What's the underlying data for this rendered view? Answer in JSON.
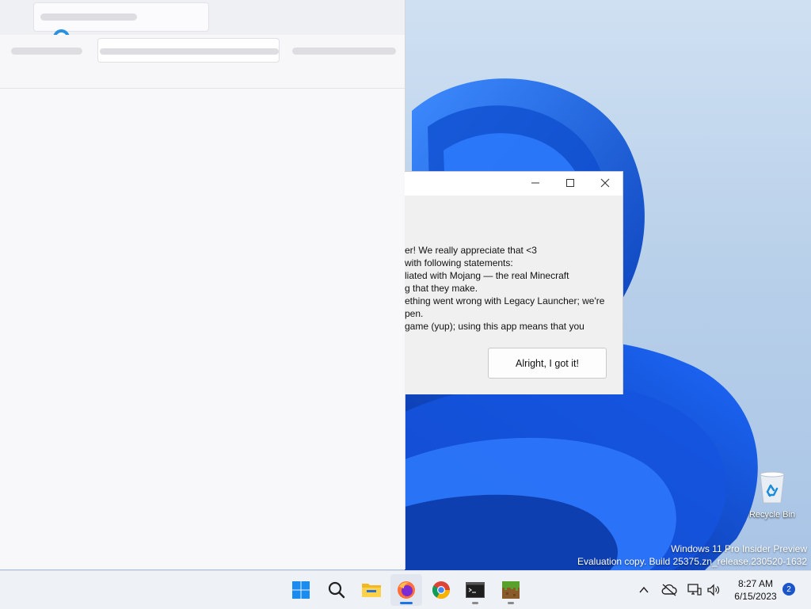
{
  "dialog": {
    "lines": [
      "er! We really appreciate that <3",
      "with following statements:",
      "liated with Mojang — the real Minecraft",
      "g that they make.",
      "ething went wrong with Legacy Launcher; we're",
      "pen.",
      "game (yup); using this app means that you"
    ],
    "ok_button": "Alright, I got it!"
  },
  "desktop": {
    "recycle_bin_label": "Recycle Bin",
    "watermark": {
      "line1": "Windows 11 Pro Insider Preview",
      "line2": "Evaluation copy. Build 25375.zn_release.230520-1632"
    }
  },
  "taskbar": {
    "apps": [
      {
        "name": "start",
        "icon": "windows-logo-icon"
      },
      {
        "name": "search",
        "icon": "search-icon"
      },
      {
        "name": "file-explorer",
        "icon": "folder-icon"
      },
      {
        "name": "firefox",
        "icon": "firefox-icon",
        "active": true
      },
      {
        "name": "chrome",
        "icon": "chrome-icon"
      },
      {
        "name": "terminal",
        "icon": "terminal-icon"
      },
      {
        "name": "minecraft",
        "icon": "grass-block-icon"
      }
    ],
    "clock": {
      "time": "8:27 AM",
      "date": "6/15/2023"
    },
    "notification_count": "2"
  },
  "colors": {
    "accent": "#1a73e8",
    "wallpaper_blue": "#1c5fd6",
    "badge": "#1a56c9"
  }
}
